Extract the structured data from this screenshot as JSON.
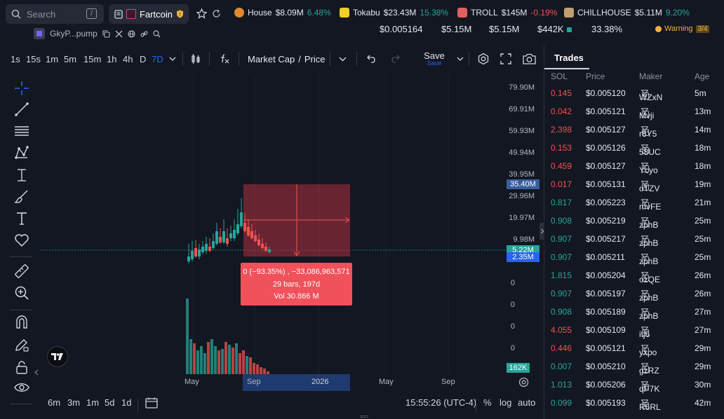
{
  "search": {
    "placeholder": "Search",
    "shortcut": "/"
  },
  "token": {
    "name": "Fartcoin"
  },
  "tickers": [
    {
      "name": "House",
      "price": "$8.09M",
      "change": "6.48%",
      "dir": "up",
      "color": "#e08a2e"
    },
    {
      "name": "Tokabu",
      "price": "$23.43M",
      "change": "15.38%",
      "dir": "up",
      "color": "#f0d020"
    },
    {
      "name": "TROLL",
      "price": "$145M",
      "change": "-0.19%",
      "dir": "dn",
      "color": "#e06060"
    },
    {
      "name": "CHILLHOUSE",
      "price": "$5.11M",
      "change": "9.20%",
      "dir": "up",
      "color": "#c0a070"
    }
  ],
  "pair": {
    "address": "GkyP...pump"
  },
  "stats": {
    "price": "$0.005164",
    "mcap": "$5.15M",
    "fdv": "$5.15M",
    "liq": "$442K",
    "pct": "33.38%"
  },
  "warning": {
    "label": "Warning",
    "count": "3/4"
  },
  "timeframes": [
    "1s",
    "15s",
    "1m",
    "5m",
    "15m",
    "1h",
    "4h",
    "D",
    "7D"
  ],
  "active_timeframe": "7D",
  "toolbar": {
    "metric": "Market Cap",
    "slash": "/",
    "metric2": "Price",
    "save": "Save",
    "save_sub": "Save"
  },
  "yaxis": [
    "79.90M",
    "69.91M",
    "59.93M",
    "49.94M",
    "39.95M",
    "29.96M",
    "19.97M",
    "9.98M",
    "0",
    "0",
    "0",
    "0"
  ],
  "price_tags": {
    "high": "35.40M",
    "current": "5.22M",
    "low": "2.35M",
    "vol": "162K"
  },
  "xaxis": [
    "May",
    "Sep",
    "2026",
    "May",
    "Sep"
  ],
  "tooltip": {
    "line1": "0 (−93.35%) , −33,086,963,571",
    "line2": "29 bars, 197d",
    "line3": "Vol 30.866 M"
  },
  "bottom": {
    "ranges": [
      "6m",
      "3m",
      "1m",
      "5d",
      "1d"
    ],
    "time": "15:55:26 (UTC-4)",
    "pct": "%",
    "log": "log",
    "auto": "auto"
  },
  "trades": {
    "title": "Trades",
    "columns": [
      "SOL",
      "Price",
      "Maker",
      "Age"
    ],
    "rows": [
      {
        "sol": "0.145",
        "price": "$0.005120",
        "maker": "WZxN",
        "age": "5m",
        "side": "sell"
      },
      {
        "sol": "0.042",
        "price": "$0.005121",
        "maker": "Mvji",
        "age": "13m",
        "side": "sell"
      },
      {
        "sol": "2.398",
        "price": "$0.005127",
        "maker": "r8Y5",
        "age": "14m",
        "side": "sell"
      },
      {
        "sol": "0.153",
        "price": "$0.005126",
        "maker": "58UC",
        "age": "18m",
        "side": "sell"
      },
      {
        "sol": "0.459",
        "price": "$0.005127",
        "maker": "Ycyo",
        "age": "18m",
        "side": "sell"
      },
      {
        "sol": "0.017",
        "price": "$0.005131",
        "maker": "oTZV",
        "age": "19m",
        "side": "sell"
      },
      {
        "sol": "0.817",
        "price": "$0.005223",
        "maker": "mvFE",
        "age": "21m",
        "side": "buy"
      },
      {
        "sol": "0.908",
        "price": "$0.005219",
        "maker": "zphB",
        "age": "25m",
        "side": "buy"
      },
      {
        "sol": "0.907",
        "price": "$0.005217",
        "maker": "zphB",
        "age": "25m",
        "side": "buy"
      },
      {
        "sol": "0.907",
        "price": "$0.005211",
        "maker": "zphB",
        "age": "25m",
        "side": "buy"
      },
      {
        "sol": "1.815",
        "price": "$0.005204",
        "maker": "ozQE",
        "age": "26m",
        "side": "buy"
      },
      {
        "sol": "0.907",
        "price": "$0.005197",
        "maker": "zphB",
        "age": "26m",
        "side": "buy"
      },
      {
        "sol": "0.908",
        "price": "$0.005189",
        "maker": "zphB",
        "age": "27m",
        "side": "buy"
      },
      {
        "sol": "4.055",
        "price": "$0.005109",
        "maker": "itj6",
        "age": "27m",
        "side": "sell"
      },
      {
        "sol": "0.446",
        "price": "$0.005121",
        "maker": "yxpo",
        "age": "29m",
        "side": "sell"
      },
      {
        "sol": "0.007",
        "price": "$0.005210",
        "maker": "gzRZ",
        "age": "29m",
        "side": "buy"
      },
      {
        "sol": "1.013",
        "price": "$0.005206",
        "maker": "qP7K",
        "age": "30m",
        "side": "buy"
      },
      {
        "sol": "0.099",
        "price": "$0.005193",
        "maker": "R6RL",
        "age": "42m",
        "side": "buy"
      }
    ]
  },
  "colors": {
    "up": "#26a69a",
    "down": "#ef5350",
    "accent": "#2962ff"
  }
}
